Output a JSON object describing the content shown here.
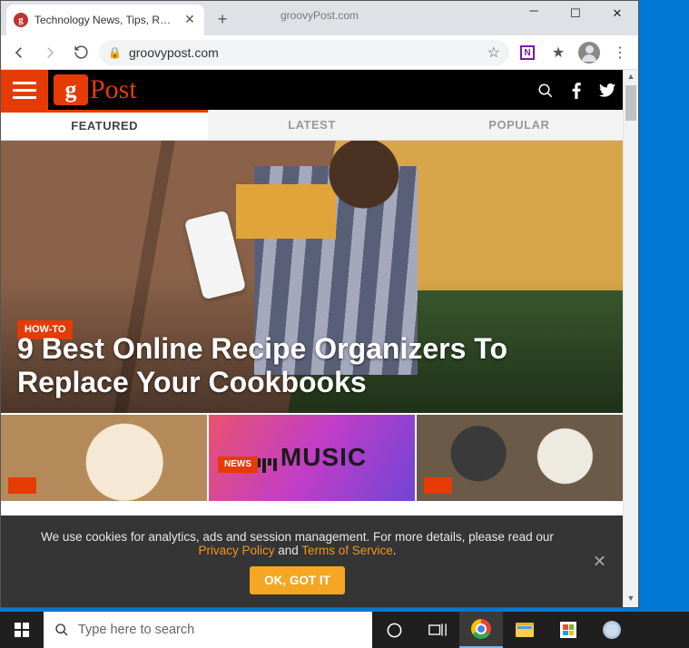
{
  "browser": {
    "tab_title": "Technology News, Tips, Reviews,",
    "hint": "groovyPost.com",
    "url": "groovypost.com",
    "favicon_letter": "g"
  },
  "site": {
    "logo_letter": "g",
    "logo_text": "Post",
    "nav": {
      "featured": "FEATURED",
      "latest": "LATEST",
      "popular": "POPULAR"
    }
  },
  "hero": {
    "category": "HOW-TO",
    "headline": "9 Best Online Recipe Organizers To Replace Your Cookbooks"
  },
  "cards": {
    "c2_tag": "NEWS",
    "c2_text": "MUSIC"
  },
  "cookie": {
    "text1": "We use cookies for analytics, ads and session management. For more details, please read our ",
    "privacy": "Privacy Policy",
    "and": " and ",
    "terms": "Terms of Service",
    "period": ".",
    "ok": "OK, GOT IT"
  },
  "taskbar": {
    "search_placeholder": "Type here to search"
  }
}
